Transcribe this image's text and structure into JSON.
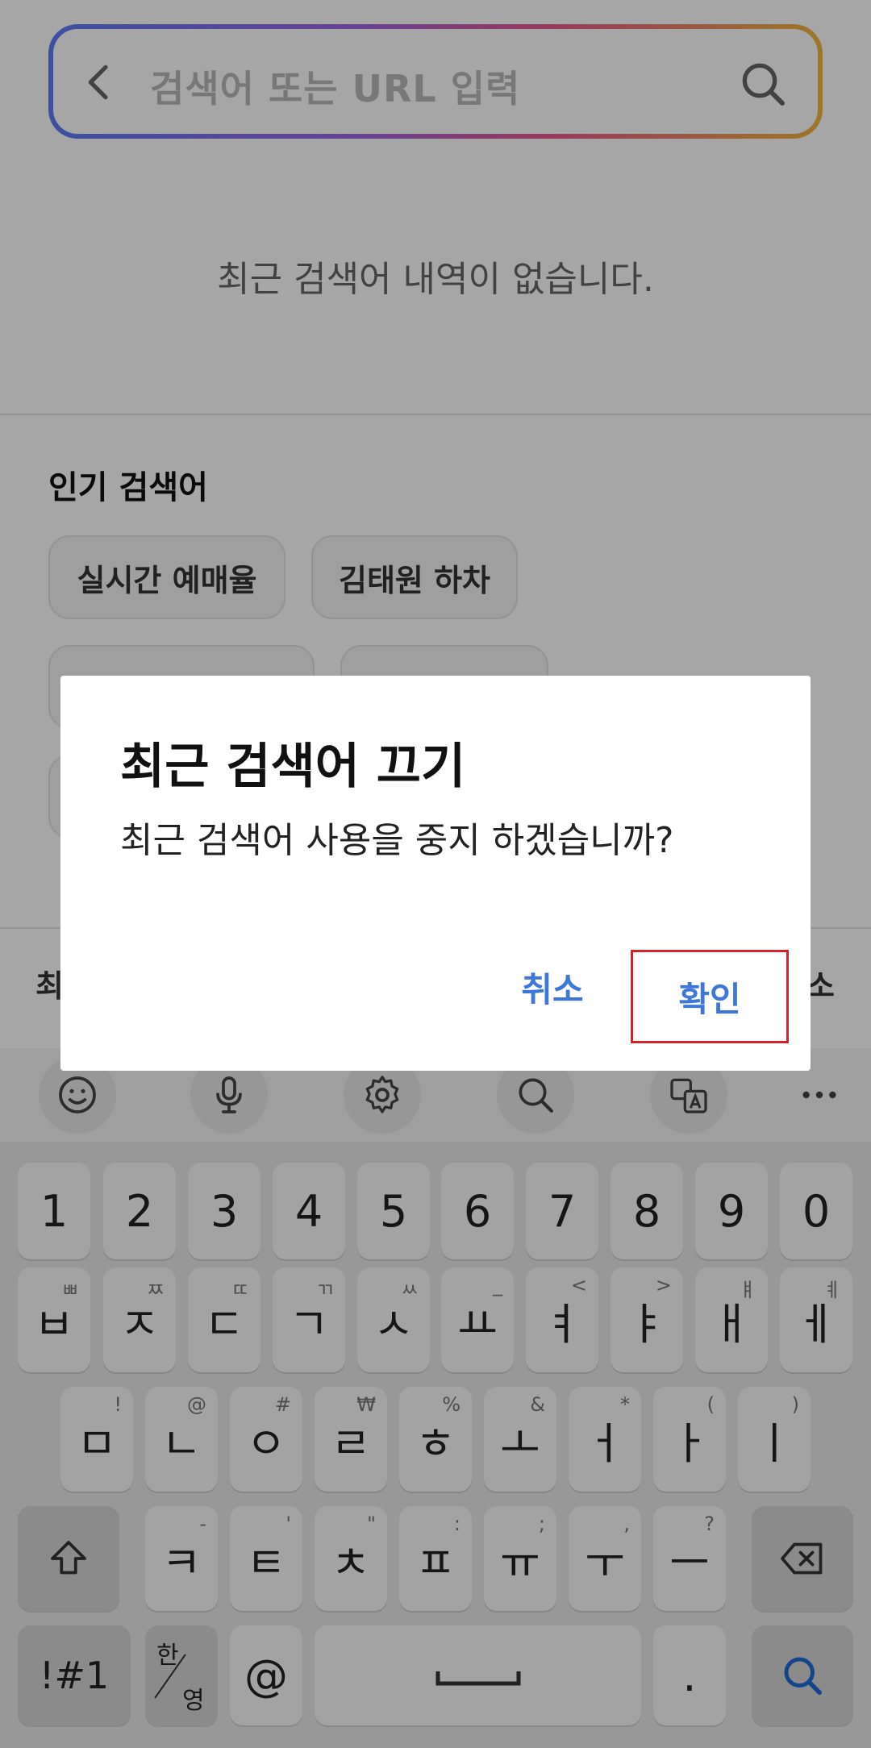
{
  "search": {
    "placeholder": "검색어 또는 URL 입력"
  },
  "recent": {
    "empty_message": "최근 검색어 내역이 없습니다."
  },
  "popular": {
    "title": "인기 검색어",
    "chips": [
      "실시간 예매율",
      "김태원 하차"
    ]
  },
  "bottom": {
    "left_fragment": "최",
    "right_fragment": "소"
  },
  "dialog": {
    "title": "최근 검색어 끄기",
    "message": "최근 검색어 사용을 중지 하겠습니까?",
    "cancel_label": "취소",
    "confirm_label": "확인"
  },
  "keyboard": {
    "number_row": [
      "1",
      "2",
      "3",
      "4",
      "5",
      "6",
      "7",
      "8",
      "9",
      "0"
    ],
    "row1": [
      {
        "main": "ㅂ",
        "hint": "ㅃ"
      },
      {
        "main": "ㅈ",
        "hint": "ㅉ"
      },
      {
        "main": "ㄷ",
        "hint": "ㄸ"
      },
      {
        "main": "ㄱ",
        "hint": "ㄲ"
      },
      {
        "main": "ㅅ",
        "hint": "ㅆ"
      },
      {
        "main": "ㅛ",
        "hint": "_"
      },
      {
        "main": "ㅕ",
        "hint": "<"
      },
      {
        "main": "ㅑ",
        "hint": ">"
      },
      {
        "main": "ㅐ",
        "hint": "ㅒ"
      },
      {
        "main": "ㅔ",
        "hint": "ㅖ"
      }
    ],
    "row2": [
      {
        "main": "ㅁ",
        "hint": "!"
      },
      {
        "main": "ㄴ",
        "hint": "@"
      },
      {
        "main": "ㅇ",
        "hint": "#"
      },
      {
        "main": "ㄹ",
        "hint": "₩"
      },
      {
        "main": "ㅎ",
        "hint": "%"
      },
      {
        "main": "ㅗ",
        "hint": "&"
      },
      {
        "main": "ㅓ",
        "hint": "*"
      },
      {
        "main": "ㅏ",
        "hint": "("
      },
      {
        "main": "ㅣ",
        "hint": ")"
      }
    ],
    "row3": [
      {
        "main": "ㅋ",
        "hint": "-"
      },
      {
        "main": "ㅌ",
        "hint": "'"
      },
      {
        "main": "ㅊ",
        "hint": "\""
      },
      {
        "main": "ㅍ",
        "hint": ":"
      },
      {
        "main": "ㅠ",
        "hint": ";"
      },
      {
        "main": "ㅜ",
        "hint": ","
      },
      {
        "main": "ㅡ",
        "hint": "?"
      }
    ],
    "symbols_label": "!#1",
    "lang_han": "한",
    "lang_eng": "영",
    "at_label": "@",
    "period_label": "."
  },
  "colors": {
    "accent_blue": "#3d78d8",
    "confirm_outline": "#d2232a",
    "search_gradient": [
      "#5b7df5",
      "#a064e0",
      "#e85a8e",
      "#f0b840"
    ]
  },
  "icons": {
    "toolbar": [
      "emoji-icon",
      "microphone-icon",
      "settings-icon",
      "search-icon",
      "translate-icon",
      "more-icon"
    ]
  }
}
